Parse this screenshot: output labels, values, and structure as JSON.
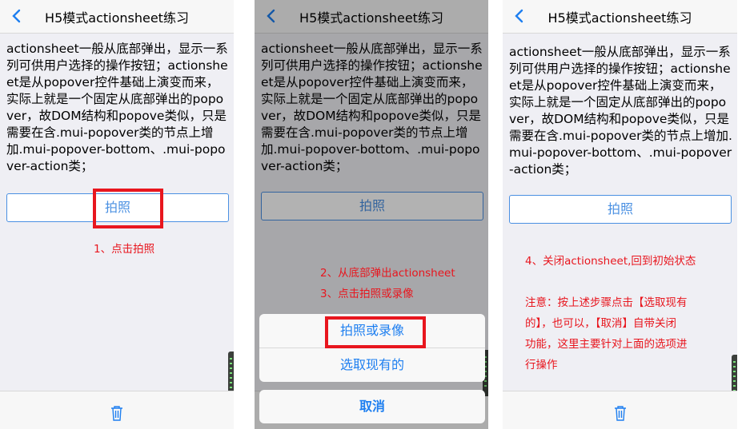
{
  "nav": {
    "title": "H5模式actionsheet练习",
    "back_icon": "chevron-left-icon"
  },
  "body_text": "actionsheet一般从底部弹出，显示一系列可供用户选择的操作按钮；actionsheet是从popover控件基础上演变而来，实际上就是一个固定从底部弹出的popover，故DOM结构和popove类似，只是需要在含.mui-popover类的节点上增加.mui-popover-bottom、.mui-popover-action类；",
  "photo_button": "拍照",
  "annotations": {
    "step1": "1、点击拍照",
    "step2": "2、从底部弹出actionsheet",
    "step3": "3、点击拍照或录像",
    "step4": "4、关闭actionsheet,回到初始状态",
    "note_line1": "注意：按上述步骤点击【选取现有",
    "note_line2": "的】，也可以，【取消】自带关闭",
    "note_line3": "功能，这里主要针对上面的选项进",
    "note_line4": "行操作"
  },
  "actionsheet": {
    "option1": "拍照或录像",
    "option2": "选取现有的",
    "cancel": "取消"
  },
  "colors": {
    "accent": "#4a90e2",
    "annotation": "#e8161e",
    "highlight_box": "#e8161e"
  },
  "bottom_icon": "trash-icon"
}
